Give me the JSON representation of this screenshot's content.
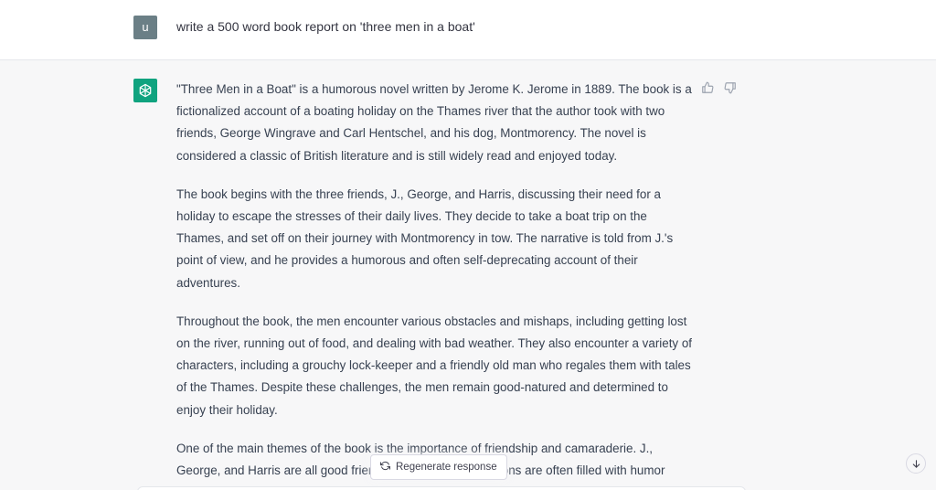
{
  "user": {
    "avatar_letter": "u",
    "message": "write a 500 word book report on 'three men in a boat'"
  },
  "assistant": {
    "paragraphs": [
      "\"Three Men in a Boat\" is a humorous novel written by Jerome K. Jerome in 1889. The book is a fictionalized account of a boating holiday on the Thames river that the author took with two friends, George Wingrave and Carl Hentschel, and his dog, Montmorency. The novel is considered a classic of British literature and is still widely read and enjoyed today.",
      "The book begins with the three friends, J., George, and Harris, discussing their need for a holiday to escape the stresses of their daily lives. They decide to take a boat trip on the Thames, and set off on their journey with Montmorency in tow. The narrative is told from J.'s point of view, and he provides a humorous and often self-deprecating account of their adventures.",
      "Throughout the book, the men encounter various obstacles and mishaps, including getting lost on the river, running out of food, and dealing with bad weather. They also encounter a variety of characters, including a grouchy lock-keeper and a friendly old man who regales them with tales of the Thames. Despite these challenges, the men remain good-natured and determined to enjoy their holiday.",
      "One of the main themes of the book is the importance of friendship and camaraderie. J., George, and Harris are all good friends, and their conversations are often filled with humor"
    ]
  },
  "controls": {
    "regenerate_label": "Regenerate response"
  },
  "icons": {
    "bot_avatar": "openai-logo-icon",
    "thumbs_up": "thumbs-up-icon",
    "thumbs_down": "thumbs-down-icon",
    "regenerate": "refresh-icon",
    "scroll_down": "arrow-down-icon"
  },
  "colors": {
    "bot_avatar_bg": "#10a37f",
    "user_avatar_bg": "#6b7f86",
    "assistant_bg": "#f7f7f8"
  }
}
